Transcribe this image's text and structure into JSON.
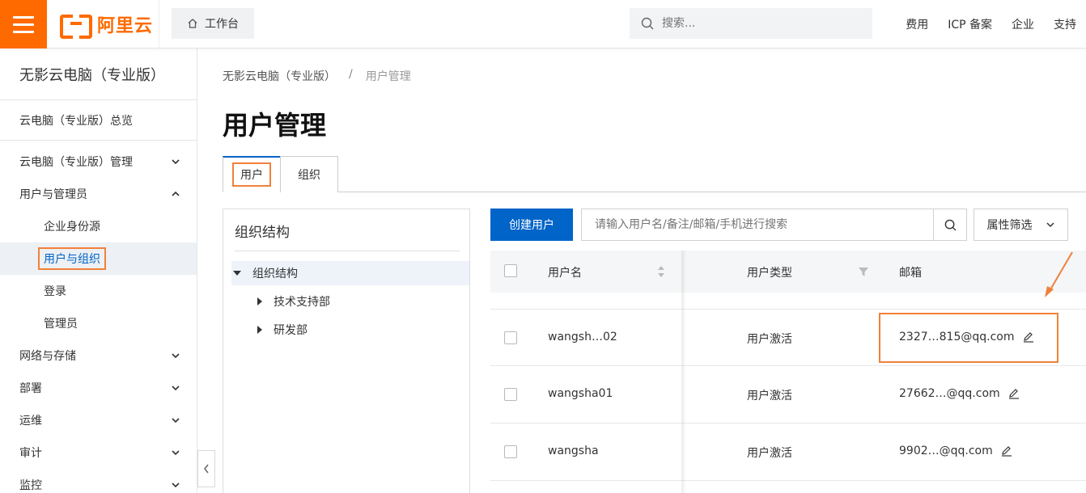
{
  "topbar": {
    "logo_text": "阿里云",
    "workbench_label": "工作台",
    "search_placeholder": "搜索...",
    "links": [
      "费用",
      "ICP 备案",
      "企业",
      "支持"
    ]
  },
  "sidebar": {
    "title": "无影云电脑（专业版）",
    "overview": "云电脑（专业版）总览",
    "items": [
      {
        "label": "云电脑（专业版）管理",
        "expanded": false
      },
      {
        "label": "用户与管理员",
        "expanded": true
      },
      {
        "label": "网络与存储",
        "expanded": false
      },
      {
        "label": "部署",
        "expanded": false
      },
      {
        "label": "运维",
        "expanded": false
      },
      {
        "label": "审计",
        "expanded": false
      },
      {
        "label": "监控",
        "expanded": false
      }
    ],
    "subitems": [
      "企业身份源",
      "用户与组织",
      "登录",
      "管理员"
    ],
    "active_subitem": "用户与组织"
  },
  "main": {
    "breadcrumb": [
      "无影云电脑（专业版）",
      "/",
      "用户管理"
    ],
    "title": "用户管理",
    "tabs": [
      "用户",
      "组织"
    ],
    "org": {
      "title": "组织结构",
      "root": "组织结构",
      "children": [
        "技术支持部",
        "研发部"
      ]
    },
    "create_button": "创建用户",
    "search_placeholder": "请输入用户名/备注/邮箱/手机进行搜索",
    "filter_button": "属性筛选",
    "table": {
      "headers": [
        "用户名",
        "用户类型",
        "邮箱"
      ],
      "rows": [
        {
          "username": "wangsh…02",
          "type": "用户激活",
          "email": "2327…815@qq.com"
        },
        {
          "username": "wangsha01",
          "type": "用户激活",
          "email": "27662…@qq.com"
        },
        {
          "username": "wangsha",
          "type": "用户激活",
          "email": "9902…@qq.com"
        }
      ]
    }
  },
  "colors": {
    "brand_orange": "#ff6a00",
    "primary_blue": "#0064c8",
    "annotation_orange": "#f0813a"
  }
}
